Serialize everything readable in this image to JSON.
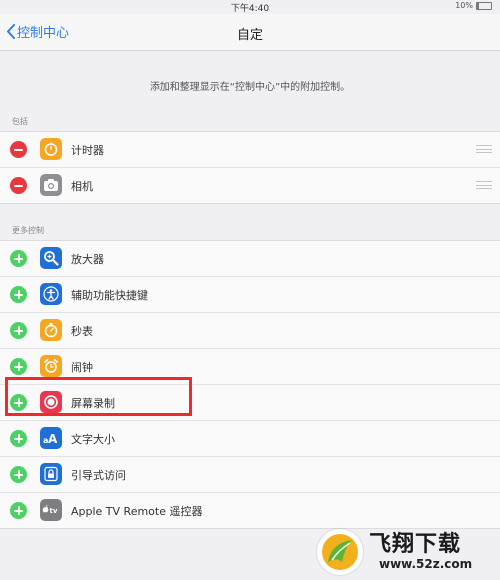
{
  "status_bar": {
    "time": "下午4:40",
    "battery": "10%"
  },
  "nav": {
    "back_label": "控制中心",
    "title": "自定"
  },
  "description": "添加和整理显示在“控制中心”中的附加控制。",
  "include_section": {
    "label": "包括",
    "items": [
      {
        "label": "计时器",
        "icon": "timer-icon",
        "color": "#f5a623"
      },
      {
        "label": "相机",
        "icon": "camera-icon",
        "color": "#8e8e93"
      }
    ]
  },
  "more_section": {
    "label": "更多控制",
    "items": [
      {
        "label": "放大器",
        "icon": "magnifier-icon",
        "color": "#1f6fd6"
      },
      {
        "label": "辅助功能快捷键",
        "icon": "accessibility-icon",
        "color": "#1f6fd6"
      },
      {
        "label": "秒表",
        "icon": "stopwatch-icon",
        "color": "#f5a623"
      },
      {
        "label": "闹钟",
        "icon": "alarm-icon",
        "color": "#f5a623"
      },
      {
        "label": "屏幕录制",
        "icon": "screen-record-icon",
        "color": "#e8384f"
      },
      {
        "label": "文字大小",
        "icon": "text-size-icon",
        "color": "#1f6fd6"
      },
      {
        "label": "引导式访问",
        "icon": "lock-icon",
        "color": "#1f6fd6"
      },
      {
        "label": "Apple TV Remote 遥控器",
        "icon": "apple-tv-icon",
        "color": "#7d7d82"
      }
    ]
  },
  "colors": {
    "accent": "#2f7cf6",
    "remove": "#e5393f",
    "add": "#4cd264",
    "highlight": "#ee2a2a"
  },
  "watermark": {
    "brand": "飞翔下载",
    "url": "www.52z.com"
  }
}
